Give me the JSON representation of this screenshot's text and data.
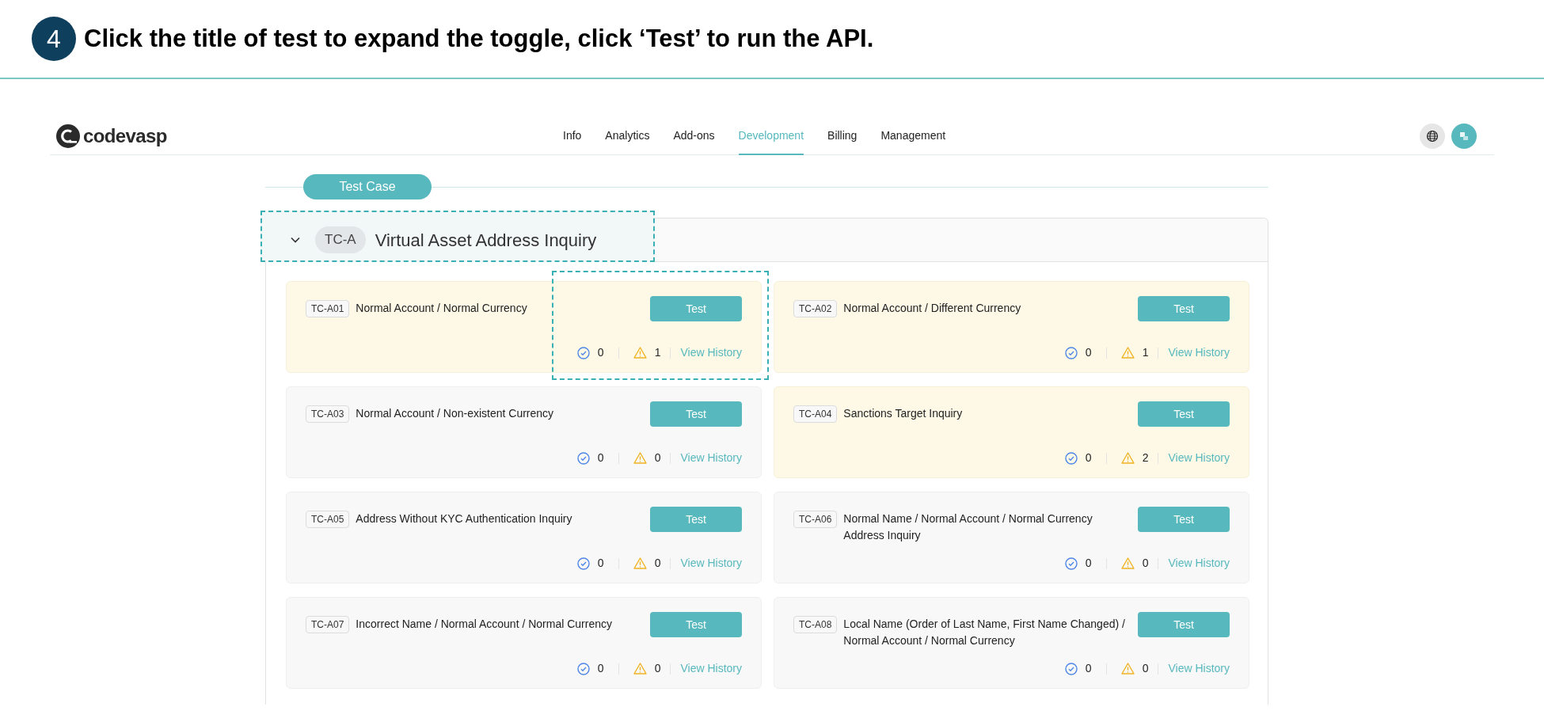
{
  "step": {
    "number": "4",
    "instruction": "Click the title of test to expand the toggle, click ‘Test’ to run the API."
  },
  "logo": {
    "text": "codevasp"
  },
  "nav": [
    {
      "label": "Info",
      "selected": false
    },
    {
      "label": "Analytics",
      "selected": false
    },
    {
      "label": "Add-ons",
      "selected": false
    },
    {
      "label": "Development",
      "selected": true
    },
    {
      "label": "Billing",
      "selected": false
    },
    {
      "label": "Management",
      "selected": false
    }
  ],
  "section": {
    "label": "Test Case"
  },
  "group": {
    "expanded": true,
    "annotated": true,
    "code": "TC-A",
    "title": "Virtual Asset Address Inquiry"
  },
  "cases": [
    {
      "code": "TC-A01",
      "title": "Normal Account / Normal Currency",
      "highlighted": true,
      "annotated": true,
      "button": "Test",
      "passed": "0",
      "warnings": "1",
      "link": "View History"
    },
    {
      "code": "TC-A02",
      "title": "Normal Account / Different Currency",
      "highlighted": true,
      "annotated": false,
      "button": "Test",
      "passed": "0",
      "warnings": "1",
      "link": "View History"
    },
    {
      "code": "TC-A03",
      "title": "Normal Account / Non-existent Currency",
      "highlighted": false,
      "annotated": false,
      "button": "Test",
      "passed": "0",
      "warnings": "0",
      "link": "View History"
    },
    {
      "code": "TC-A04",
      "title": "Sanctions Target Inquiry",
      "highlighted": true,
      "annotated": false,
      "button": "Test",
      "passed": "0",
      "warnings": "2",
      "link": "View History"
    },
    {
      "code": "TC-A05",
      "title": "Address Without KYC Authentication Inquiry",
      "highlighted": false,
      "annotated": false,
      "button": "Test",
      "passed": "0",
      "warnings": "0",
      "link": "View History"
    },
    {
      "code": "TC-A06",
      "title": "Normal Name / Normal Account / Normal Currency Address Inquiry",
      "highlighted": false,
      "annotated": false,
      "button": "Test",
      "passed": "0",
      "warnings": "0",
      "link": "View History"
    },
    {
      "code": "TC-A07",
      "title": "Incorrect Name / Normal Account / Normal Currency",
      "highlighted": false,
      "annotated": false,
      "button": "Test",
      "passed": "0",
      "warnings": "0",
      "link": "View History"
    },
    {
      "code": "TC-A08",
      "title": "Local Name (Order of Last Name, First Name Changed) / Normal Account / Normal Currency",
      "highlighted": false,
      "annotated": false,
      "button": "Test",
      "passed": "0",
      "warnings": "0",
      "link": "View History"
    }
  ]
}
